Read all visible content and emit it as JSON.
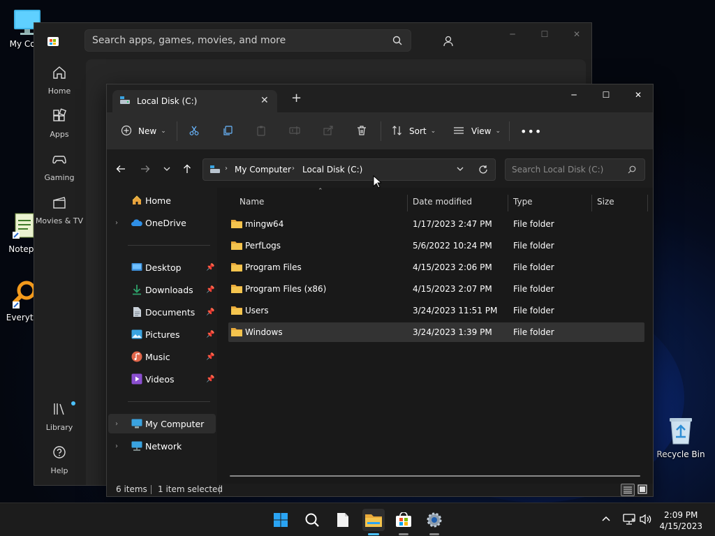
{
  "desktop": {
    "icons": [
      {
        "label": "My Com"
      },
      {
        "label": "Notepa"
      },
      {
        "label": "Everyth"
      },
      {
        "label": "Recycle Bin"
      }
    ]
  },
  "store": {
    "search_placeholder": "Search apps, games, movies, and more",
    "nav": [
      {
        "label": "Home",
        "icon": "home-icon"
      },
      {
        "label": "Apps",
        "icon": "apps-icon"
      },
      {
        "label": "Gaming",
        "icon": "gaming-icon"
      },
      {
        "label": "Movies & TV",
        "icon": "movies-icon"
      },
      {
        "label": "Library",
        "icon": "library-icon"
      },
      {
        "label": "Help",
        "icon": "help-icon"
      }
    ]
  },
  "explorer": {
    "tab_title": "Local Disk (C:)",
    "toolbar": {
      "new_label": "New",
      "sort_label": "Sort",
      "view_label": "View"
    },
    "breadcrumb": [
      "My Computer",
      "Local Disk (C:)"
    ],
    "search_placeholder": "Search Local Disk (C:)",
    "sidebar": {
      "home": "Home",
      "onedrive": "OneDrive",
      "quick": [
        {
          "label": "Desktop",
          "icon": "desktop-folder-icon",
          "color": "#3d8fd9"
        },
        {
          "label": "Downloads",
          "icon": "downloads-icon",
          "color": "#2ea36b"
        },
        {
          "label": "Documents",
          "icon": "documents-icon",
          "color": "#8f9aa6"
        },
        {
          "label": "Pictures",
          "icon": "pictures-icon",
          "color": "#3aa3e0"
        },
        {
          "label": "Music",
          "icon": "music-icon",
          "color": "#e0664a"
        },
        {
          "label": "Videos",
          "icon": "videos-icon",
          "color": "#8b4fd0"
        }
      ],
      "my_computer": "My Computer",
      "network": "Network"
    },
    "columns": {
      "name": "Name",
      "date": "Date modified",
      "type": "Type",
      "size": "Size"
    },
    "files": [
      {
        "name": "mingw64",
        "date": "1/17/2023 2:47 PM",
        "type": "File folder"
      },
      {
        "name": "PerfLogs",
        "date": "5/6/2022 10:24 PM",
        "type": "File folder"
      },
      {
        "name": "Program Files",
        "date": "4/15/2023 2:06 PM",
        "type": "File folder"
      },
      {
        "name": "Program Files (x86)",
        "date": "4/15/2023 2:07 PM",
        "type": "File folder"
      },
      {
        "name": "Users",
        "date": "3/24/2023 11:51 PM",
        "type": "File folder"
      },
      {
        "name": "Windows",
        "date": "3/24/2023 1:39 PM",
        "type": "File folder",
        "selected": true
      }
    ],
    "status": {
      "items": "6 items",
      "selected": "1 item selected"
    }
  },
  "taskbar": {
    "time": "2:09 PM",
    "date": "4/15/2023",
    "apps": [
      "start-icon",
      "search-icon",
      "notepad-icon",
      "file-explorer-icon",
      "store-icon",
      "settings-icon"
    ]
  },
  "colors": {
    "accent": "#4cc2ff",
    "folder": "#f4c44e"
  }
}
